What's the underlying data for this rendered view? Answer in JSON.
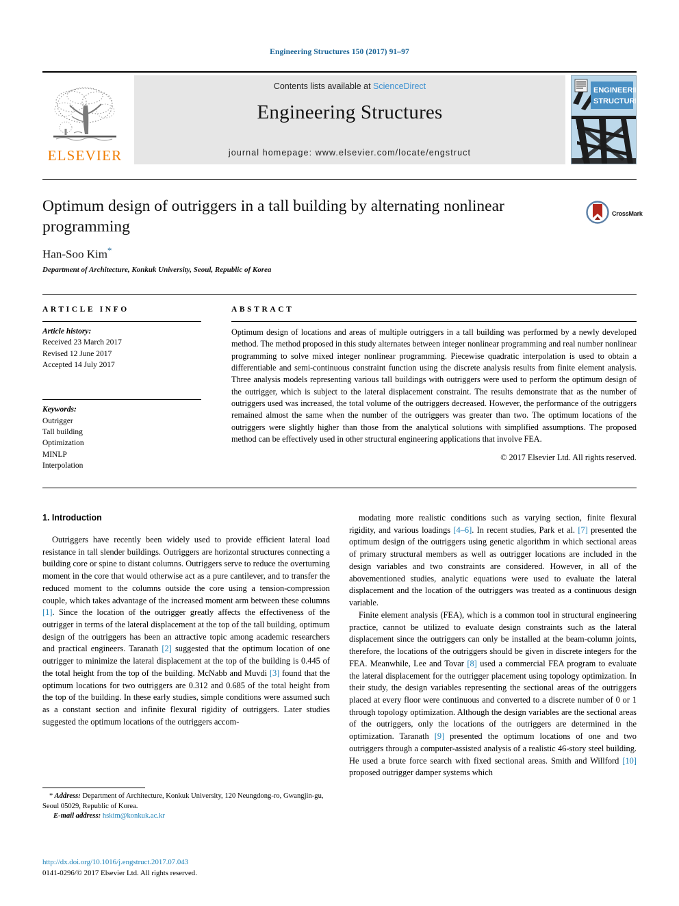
{
  "running_head": "Engineering Structures 150 (2017) 91–97",
  "masthead": {
    "publisher": "ELSEVIER",
    "contents_prefix": "Contents lists available at ",
    "sciencedirect": "ScienceDirect",
    "journal_title": "Engineering Structures",
    "homepage": "journal homepage: www.elsevier.com/locate/engstruct",
    "cover_line1": "ENGINEERING",
    "cover_line2": "STRUCTURES"
  },
  "article": {
    "title": "Optimum design of outriggers in a tall building by alternating nonlinear programming",
    "crossmark_label": "CrossMark",
    "author": "Han-Soo Kim",
    "author_marker": "*",
    "affiliation": "Department of Architecture, Konkuk University, Seoul, Republic of Korea"
  },
  "article_info": {
    "heading": "ARTICLE INFO",
    "history_label": "Article history:",
    "history": [
      "Received 23 March 2017",
      "Revised 12 June 2017",
      "Accepted 14 July 2017"
    ],
    "keywords_label": "Keywords:",
    "keywords": [
      "Outrigger",
      "Tall building",
      "Optimization",
      "MINLP",
      "Interpolation"
    ]
  },
  "abstract": {
    "heading": "ABSTRACT",
    "text": "Optimum design of locations and areas of multiple outriggers in a tall building was performed by a newly developed method. The method proposed in this study alternates between integer nonlinear programming and real number nonlinear programming to solve mixed integer nonlinear programming. Piecewise quadratic interpolation is used to obtain a differentiable and semi-continuous constraint function using the discrete analysis results from finite element analysis. Three analysis models representing various tall buildings with outriggers were used to perform the optimum design of the outrigger, which is subject to the lateral displacement constraint. The results demonstrate that as the number of outriggers used was increased, the total volume of the outriggers decreased. However, the performance of the outriggers remained almost the same when the number of the outriggers was greater than two. The optimum locations of the outriggers were slightly higher than those from the analytical solutions with simplified assumptions. The proposed method can be effectively used in other structural engineering applications that involve FEA.",
    "copyright": "© 2017 Elsevier Ltd. All rights reserved."
  },
  "body": {
    "section_title": "1. Introduction",
    "left_p1_a": "Outriggers have recently been widely used to provide efficient lateral load resistance in tall slender buildings. Outriggers are horizontal structures connecting a building core or spine to distant columns. Outriggers serve to reduce the overturning moment in the core that would otherwise act as a pure cantilever, and to transfer the reduced moment to the columns outside the core using a tension-compression couple, which takes advantage of the increased moment arm between these columns ",
    "left_ref1": "[1]",
    "left_p1_b": ". Since the location of the outrigger greatly affects the effectiveness of the outrigger in terms of the lateral displacement at the top of the tall building, optimum design of the outriggers has been an attractive topic among academic researchers and practical engineers. Taranath ",
    "left_ref2": "[2]",
    "left_p1_c": " suggested that the optimum location of one outrigger to minimize the lateral displacement at the top of the building is 0.445 of the total height from the top of the building. McNabb and Muvdi ",
    "left_ref3": "[3]",
    "left_p1_d": " found that the optimum locations for two outriggers are 0.312 and 0.685 of the total height from the top of the building. In these early studies, simple conditions were assumed such as a constant section and infinite flexural rigidity of outriggers. Later studies suggested the optimum locations of the outriggers accom-",
    "right_p1_a": "modating more realistic conditions such as varying section, finite flexural rigidity, and various loadings ",
    "right_ref46": "[4–6]",
    "right_p1_b": ". In recent studies, Park et al. ",
    "right_ref7": "[7]",
    "right_p1_c": " presented the optimum design of the outriggers using genetic algorithm in which sectional areas of primary structural members as well as outrigger locations are included in the design variables and two constraints are considered. However, in all of the abovementioned studies, analytic equations were used to evaluate the lateral displacement and the location of the outriggers was treated as a continuous design variable.",
    "right_p2_a": "Finite element analysis (FEA), which is a common tool in structural engineering practice, cannot be utilized to evaluate design constraints such as the lateral displacement since the outriggers can only be installed at the beam-column joints, therefore, the locations of the outriggers should be given in discrete integers for the FEA. Meanwhile, Lee and Tovar ",
    "right_ref8": "[8]",
    "right_p2_b": " used a commercial FEA program to evaluate the lateral displacement for the outrigger placement using topology optimization. In their study, the design variables representing the sectional areas of the outriggers placed at every floor were continuous and converted to a discrete number of 0 or 1 through topology optimization. Although the design variables are the sectional areas of the outriggers, only the locations of the outriggers are determined in the optimization. Taranath ",
    "right_ref9": "[9]",
    "right_p2_c": " presented the optimum locations of one and two outriggers through a computer-assisted analysis of a realistic 46-story steel building. He used a brute force search with fixed sectional areas. Smith and Willford ",
    "right_ref10": "[10]",
    "right_p2_d": " proposed outrigger damper systems which"
  },
  "footnote": {
    "marker": "*",
    "address_label": " Address:",
    "address": " Department of Architecture, Konkuk University, 120 Neungdong-ro, Gwangjin-gu, Seoul 05029, Republic of Korea.",
    "email_label": "E-mail address:",
    "email": "hskim@konkuk.ac.kr"
  },
  "doi": {
    "url": "http://dx.doi.org/10.1016/j.engstruct.2017.07.043",
    "issn_line": "0141-0296/© 2017 Elsevier Ltd. All rights reserved."
  },
  "colors": {
    "link": "#1a7fb5",
    "sciencedirect": "#3a8fd0",
    "elsevier_orange": "#f07c00",
    "banner_bg": "#e6e6e6"
  }
}
